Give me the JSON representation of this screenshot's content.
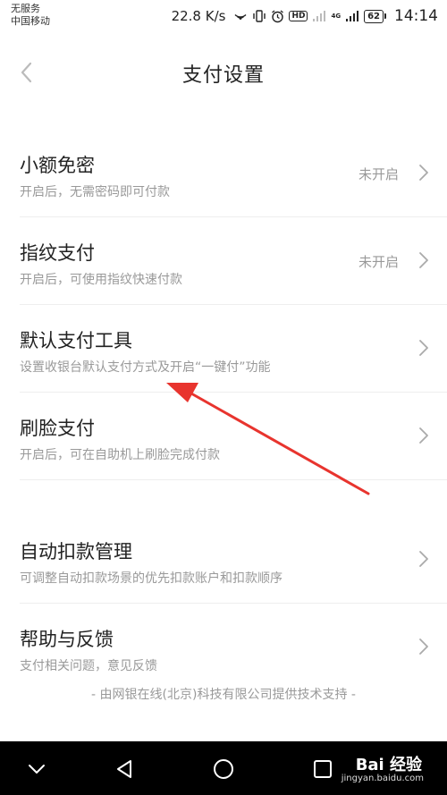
{
  "status_bar": {
    "carrier_line1": "无服务",
    "carrier_line2": "中国移动",
    "net_speed": "22.8 K/s",
    "hd_badge": "HD",
    "network_type": "4G",
    "battery": "62",
    "time": "14:14"
  },
  "header": {
    "title": "支付设置",
    "back_icon": "chevron-left-icon"
  },
  "settings": [
    {
      "title": "小额免密",
      "subtitle": "开启后，无需密码即可付款",
      "status": "未开启"
    },
    {
      "title": "指纹支付",
      "subtitle": "开启后，可使用指纹快速付款",
      "status": "未开启"
    },
    {
      "title": "默认支付工具",
      "subtitle": "设置收银台默认支付方式及开启“一键付”功能",
      "status": ""
    },
    {
      "title": "刷脸支付",
      "subtitle": "开启后，可在自助机上刷脸完成付款",
      "status": ""
    },
    {
      "title": "自动扣款管理",
      "subtitle": "可调整自动扣款场景的优先扣款账户和扣款顺序",
      "status": ""
    },
    {
      "title": "帮助与反馈",
      "subtitle": "支付相关问题，意见反馈",
      "status": ""
    }
  ],
  "footer": {
    "text": "- 由网银在线(北京)科技有限公司提供技术支持 -"
  },
  "nav_bar": {
    "icons": [
      "chevron-down-icon",
      "back-triangle-icon",
      "home-circle-icon",
      "recents-square-icon"
    ],
    "watermark": "Bai 经验",
    "watermark_url": "jingyan.baidu.com"
  },
  "colors": {
    "annotation_arrow": "#e8342e",
    "secondary_text": "#999999",
    "divider": "#eeeeee"
  }
}
